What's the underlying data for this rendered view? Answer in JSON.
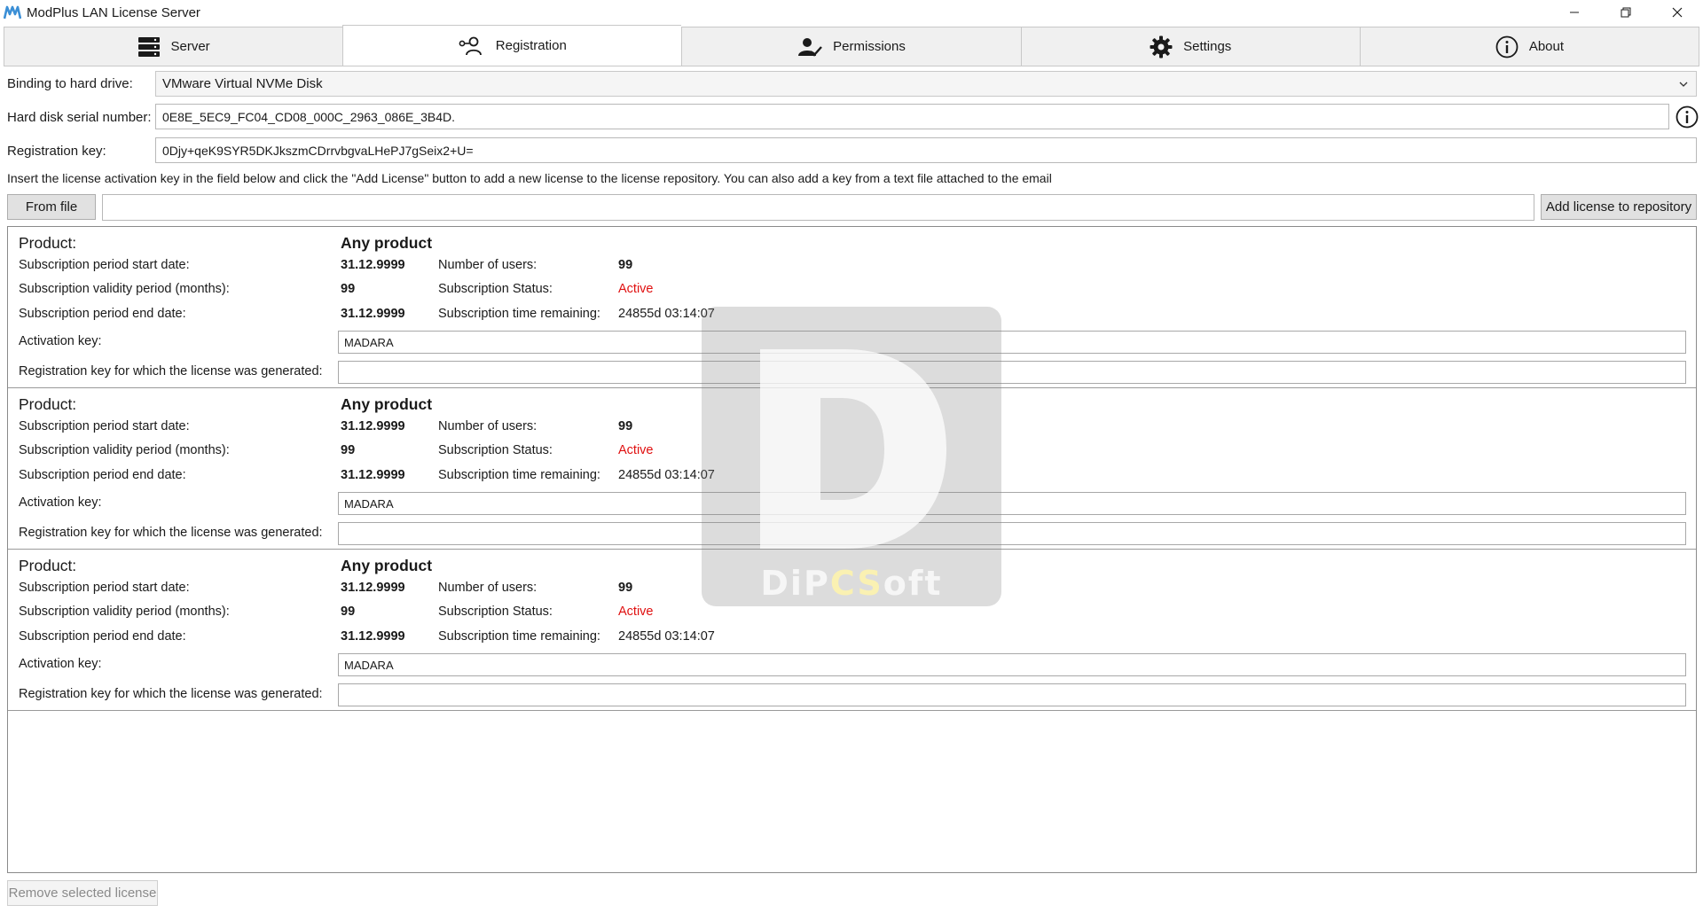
{
  "window": {
    "title": "ModPlus LAN License Server",
    "controls": [
      "minimize-icon",
      "restore-icon",
      "close-icon"
    ]
  },
  "tabs": [
    {
      "label": "Server",
      "icon": "server-icon",
      "active": false
    },
    {
      "label": "Registration",
      "icon": "user-key-icon",
      "active": true
    },
    {
      "label": "Permissions",
      "icon": "user-check-icon",
      "active": false
    },
    {
      "label": "Settings",
      "icon": "gear-icon",
      "active": false
    },
    {
      "label": "About",
      "icon": "info-icon",
      "active": false
    }
  ],
  "registration": {
    "binding_label": "Binding to hard drive:",
    "binding_value": "VMware Virtual NVMe Disk",
    "serial_label": "Hard disk serial number:",
    "serial_value": "0E8E_5EC9_FC04_CD08_000C_2963_086E_3B4D.",
    "regkey_label": "Registration key:",
    "regkey_value": "0Djy+qeK9SYR5DKJkszmCDrrvbgvaLHePJ7gSeix2+U=",
    "instruction": "Insert the license activation key in the field below and click the \"Add License\" button to add a new license to the license repository. You can also add a key from a text file attached to the email",
    "from_file_label": "From file",
    "activation_input_value": "",
    "add_license_label": "Add license to repository",
    "remove_label": "Remove selected license"
  },
  "license_labels": {
    "product": "Product:",
    "start_date": "Subscription period start date:",
    "validity": "Subscription validity period (months):",
    "end_date": "Subscription period end date:",
    "activation_key": "Activation key:",
    "reg_key_generated": "Registration key for which the license was generated:",
    "users": "Number of users:",
    "status": "Subscription Status:",
    "remaining": "Subscription time remaining:"
  },
  "licenses": [
    {
      "product": "Any product",
      "start_date": "31.12.9999",
      "validity": "99",
      "end_date": "31.12.9999",
      "users": "99",
      "status": "Active",
      "remaining": "24855d 03:14:07",
      "activation_key": "MADARA",
      "reg_key": ""
    },
    {
      "product": "Any product",
      "start_date": "31.12.9999",
      "validity": "99",
      "end_date": "31.12.9999",
      "users": "99",
      "status": "Active",
      "remaining": "24855d 03:14:07",
      "activation_key": "MADARA",
      "reg_key": ""
    },
    {
      "product": "Any product",
      "start_date": "31.12.9999",
      "validity": "99",
      "end_date": "31.12.9999",
      "users": "99",
      "status": "Active",
      "remaining": "24855d 03:14:07",
      "activation_key": "MADARA",
      "reg_key": ""
    }
  ],
  "watermark": {
    "letter": "D",
    "text_a": "DiP",
    "text_b": "CS",
    "text_c": "oft"
  },
  "colors": {
    "status_active": "#e01010",
    "tab_inactive": "#f0f0f0",
    "logo": "#3b8fd6"
  }
}
